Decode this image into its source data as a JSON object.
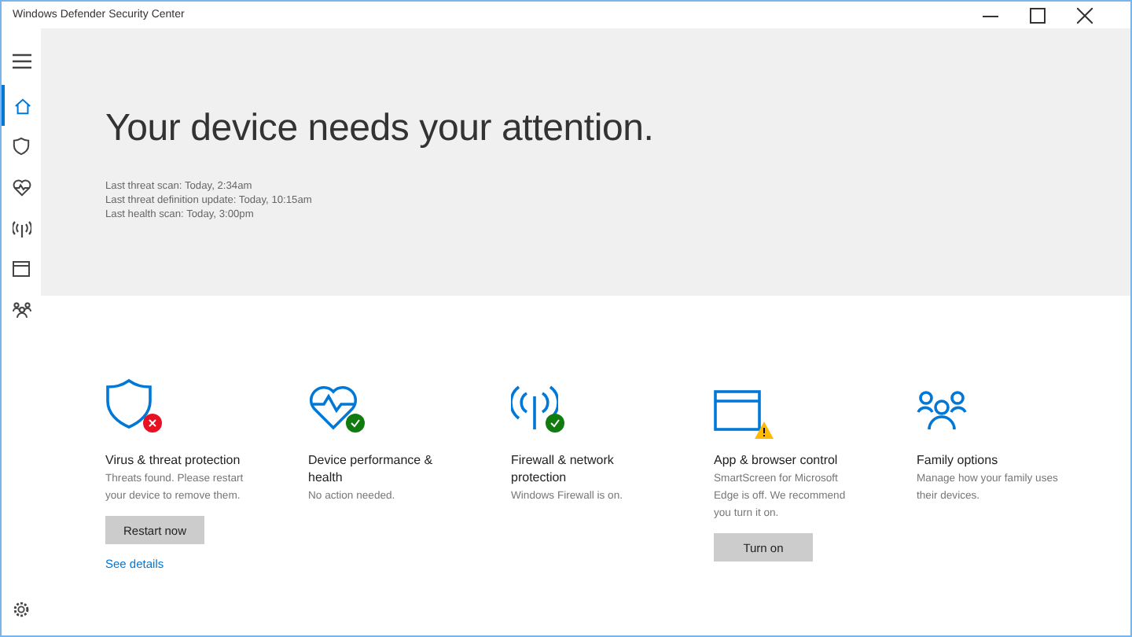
{
  "window": {
    "title": "Windows Defender Security Center"
  },
  "sidebar": {
    "items": [
      {
        "kind": "home",
        "selected": true
      },
      {
        "kind": "shield",
        "selected": false
      },
      {
        "kind": "heart",
        "selected": false
      },
      {
        "kind": "antenna",
        "selected": false
      },
      {
        "kind": "browser",
        "selected": false
      },
      {
        "kind": "family",
        "selected": false
      }
    ]
  },
  "hero": {
    "heading": "Your device needs your attention.",
    "lines": [
      "Last threat scan: Today, 2:34am",
      "Last threat definition update: Today, 10:15am",
      "Last health scan: Today, 3:00pm"
    ]
  },
  "cards": [
    {
      "kind": "virus",
      "badge": {
        "kind": "error"
      },
      "title": "Virus & threat protection",
      "description": "Threats found. Please restart your device to remove them.",
      "button": "Restart now",
      "link": "See details"
    },
    {
      "kind": "performance",
      "badge": {
        "kind": "ok"
      },
      "title": "Device performance & health",
      "description": "No action needed."
    },
    {
      "kind": "firewall",
      "badge": {
        "kind": "ok"
      },
      "title": "Firewall & network protection",
      "description": "Windows Firewall is on."
    },
    {
      "kind": "app",
      "badge": {
        "kind": "warning"
      },
      "title": "App & browser control",
      "description": "SmartScreen for Microsoft Edge is off. We recommend you turn it on.",
      "button": "Turn on"
    },
    {
      "kind": "family",
      "title": "Family options",
      "description": "Manage how your family uses their devices."
    }
  ]
}
